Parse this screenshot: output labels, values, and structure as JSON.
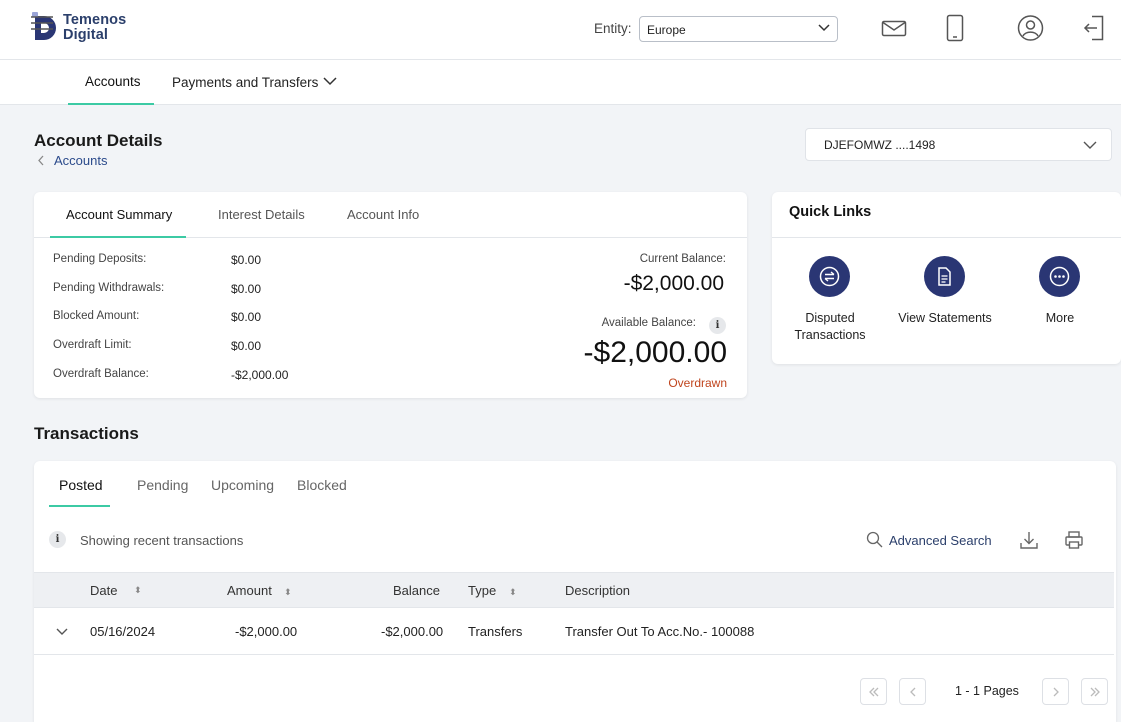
{
  "brand": {
    "line1": "Temenos",
    "line2": "Digital",
    "accent": "#2a3674"
  },
  "header": {
    "entity_label": "Entity:",
    "entity_value": "Europe",
    "icons": [
      "mail-icon",
      "mobile-icon",
      "user-profile-icon",
      "logout-icon"
    ]
  },
  "nav": {
    "menu_icon": "hamburger-icon",
    "items": [
      {
        "label": "Accounts",
        "active": true
      },
      {
        "label": "Payments and Transfers",
        "active": false
      }
    ]
  },
  "page": {
    "title": "Account Details",
    "breadcrumb": "Accounts",
    "account_selector": "DJEFOMWZ ....1498"
  },
  "summary": {
    "tabs": [
      "Account Summary",
      "Interest Details",
      "Account Info"
    ],
    "rows": [
      {
        "label": "Pending Deposits:",
        "value": "$0.00"
      },
      {
        "label": "Pending Withdrawals:",
        "value": "$0.00"
      },
      {
        "label": "Blocked Amount:",
        "value": "$0.00"
      },
      {
        "label": "Overdraft Limit:",
        "value": "$0.00"
      },
      {
        "label": "Overdraft Balance:",
        "value": "-$2,000.00"
      }
    ],
    "current_balance_label": "Current Balance:",
    "current_balance": "-$2,000.00",
    "available_balance_label": "Available Balance:",
    "available_balance": "-$2,000.00",
    "status": "Overdrawn",
    "status_color": "#c0451e"
  },
  "quick_links": {
    "title": "Quick Links",
    "items": [
      {
        "label_line1": "Disputed",
        "label_line2": "Transactions",
        "icon": "dispute-icon"
      },
      {
        "label_line1": "View Statements",
        "label_line2": "",
        "icon": "document-icon"
      },
      {
        "label_line1": "More",
        "label_line2": "",
        "icon": "more-icon"
      }
    ]
  },
  "transactions": {
    "title": "Transactions",
    "tabs": [
      "Posted",
      "Pending",
      "Upcoming",
      "Blocked"
    ],
    "info": "Showing recent transactions",
    "advanced_search": "Advanced Search",
    "columns": [
      "Date",
      "Amount",
      "Balance",
      "Type",
      "Description"
    ],
    "rows": [
      {
        "date": "05/16/2024",
        "amount": "-$2,000.00",
        "balance": "-$2,000.00",
        "type": "Transfers",
        "description": "Transfer Out To Acc.No.- 100088"
      }
    ],
    "pagination": "1 - 1 Pages"
  }
}
